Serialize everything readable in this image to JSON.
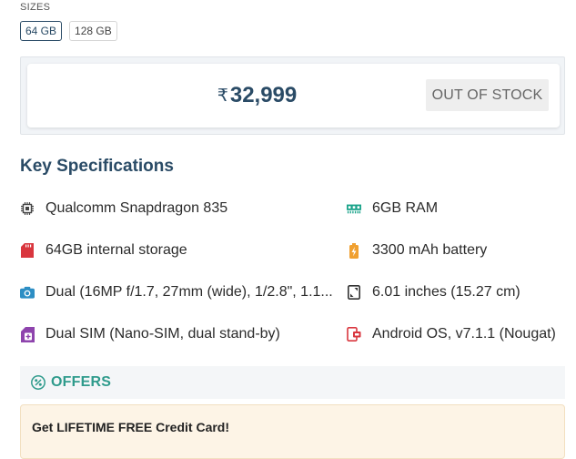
{
  "sizes": {
    "label": "SIZES",
    "options": [
      "64 GB",
      "128 GB"
    ],
    "selected": "64 GB"
  },
  "price": {
    "currency": "₹",
    "amount": "32,999",
    "stock_status": "OUT OF STOCK"
  },
  "specs": {
    "title": "Key Specifications",
    "items": [
      {
        "icon": "processor-chip-icon",
        "text": "Qualcomm Snapdragon 835"
      },
      {
        "icon": "ram-icon",
        "text": "6GB RAM"
      },
      {
        "icon": "sd-card-icon",
        "text": "64GB internal storage"
      },
      {
        "icon": "battery-icon",
        "text": "3300 mAh battery"
      },
      {
        "icon": "camera-icon",
        "text": "Dual (16MP f/1.7, 27mm (wide), 1/2.8\", 1.1..."
      },
      {
        "icon": "screen-size-icon",
        "text": "6.01 inches (15.27 cm)"
      },
      {
        "icon": "sim-card-icon",
        "text": "Dual SIM (Nano-SIM, dual stand-by)"
      },
      {
        "icon": "os-icon",
        "text": "Android OS, v7.1.1 (Nougat)"
      }
    ]
  },
  "offers": {
    "label": "OFFERS",
    "items": [
      {
        "text": "Get LIFETIME FREE Credit Card!"
      }
    ]
  },
  "colors": {
    "brand": "#2a4b66",
    "offers_accent": "#2f9b8c",
    "icon_red": "#d9363e",
    "icon_teal": "#1aa38a",
    "icon_orange": "#f0a030",
    "icon_blue": "#2d8ec4",
    "icon_purple": "#8e44ad",
    "icon_dark": "#333333"
  }
}
